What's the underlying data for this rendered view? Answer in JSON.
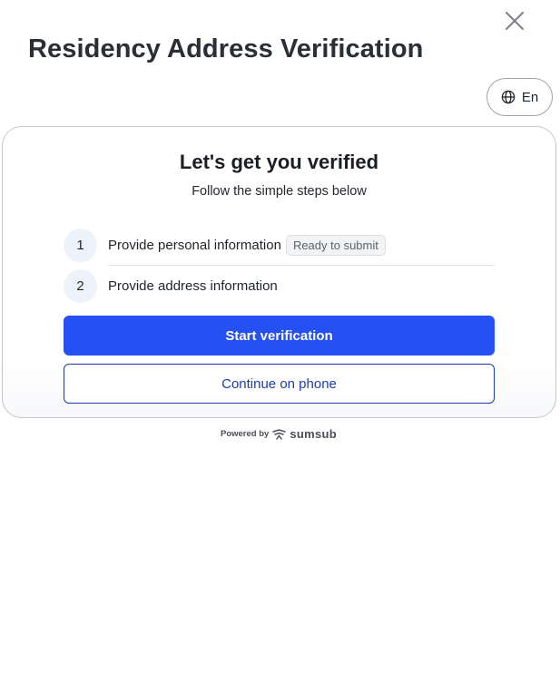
{
  "header": {
    "title": "Residency Address Verification",
    "close_icon": "close-icon",
    "language": {
      "label": "En",
      "icon": "globe-icon"
    }
  },
  "card": {
    "title": "Let's get you verified",
    "subtitle": "Follow the simple steps below",
    "steps": [
      {
        "number": "1",
        "label": "Provide personal information",
        "badge": "Ready to submit"
      },
      {
        "number": "2",
        "label": "Provide address information"
      }
    ],
    "primary_button": "Start verification",
    "secondary_button": "Continue on phone"
  },
  "footer": {
    "powered_by": "Powered by",
    "brand": "sumsub",
    "brand_icon": "sumsub-logo-icon"
  },
  "colors": {
    "primary": "#2450f4",
    "secondary_border": "#1d3aa8",
    "title_text": "#2a2e35",
    "step_circle": "#eef2fb"
  }
}
